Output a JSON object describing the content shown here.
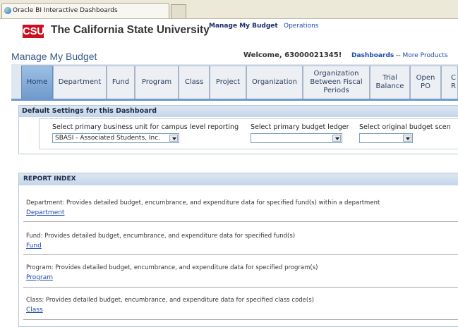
{
  "browser": {
    "tab_title": "Oracle BI Interactive Dashboards"
  },
  "header": {
    "logo_text": "CSU",
    "university": "The California State University",
    "nav_manage_budget": "Manage My Budget",
    "nav_operations": "Operations"
  },
  "titlebar": {
    "dashboard_title": "Manage My Budget",
    "welcome": "Welcome, 63000021345!",
    "dashboards_link": "Dashboards",
    "separator": "--",
    "more_products": "More Products"
  },
  "tabs": [
    {
      "label": "Home"
    },
    {
      "label": "Department"
    },
    {
      "label": "Fund"
    },
    {
      "label": "Program"
    },
    {
      "label": "Class"
    },
    {
      "label": "Project"
    },
    {
      "label": "Organization"
    },
    {
      "label": "Organization Between Fiscal Periods"
    },
    {
      "label": "Trial Balance"
    },
    {
      "label": "Open PO"
    },
    {
      "label": "C R"
    }
  ],
  "settings": {
    "heading": "Default Settings for this Dashboard",
    "business_unit_label": "Select primary business unit for campus level reporting",
    "business_unit_value": "SBASI - Associated Students, Inc.",
    "ledger_label": "Select primary budget ledger",
    "ledger_value": "",
    "scenario_label": "Select original budget scen",
    "scenario_value": ""
  },
  "report_index": {
    "heading": "REPORT INDEX",
    "items": [
      {
        "description": "Department: Provides detailed budget, encumbrance, and expenditure data for specified fund(s) within a department",
        "link": "Department"
      },
      {
        "description": "Fund: Provides detailed budget, encumbrance, and expenditure data for specified fund(s)",
        "link": "Fund"
      },
      {
        "description": "Program: Provides detailed budget, encumbrance, and expenditure data for specified program(s)",
        "link": "Program"
      },
      {
        "description": "Class: Provides detailed budget, encumbrance, and expenditure data for specified class code(s)",
        "link": "Class"
      }
    ]
  },
  "colors": {
    "brand_red": "#cc1022",
    "link_blue": "#1f4ab0",
    "active_tab": "#6f9acc"
  }
}
